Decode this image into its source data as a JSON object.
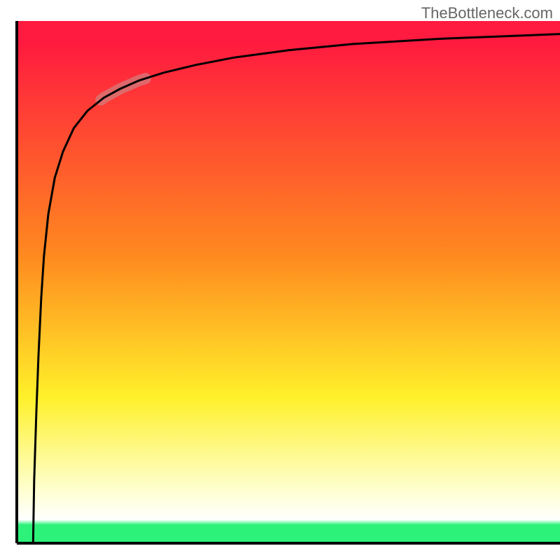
{
  "header": {
    "watermark": "TheBottleneck.com"
  },
  "chart_data": {
    "type": "line",
    "title": "",
    "xlabel": "",
    "ylabel": "",
    "xlim": [
      0,
      100
    ],
    "ylim": [
      0,
      100
    ],
    "axes": {
      "left_line_x": 3,
      "bottom_line_y": 0
    },
    "background_gradient": {
      "stops": [
        {
          "pos": 0.0,
          "color": "#ff1a3f"
        },
        {
          "pos": 0.04,
          "color": "#ff1a3f"
        },
        {
          "pos": 0.45,
          "color": "#ff8a1f"
        },
        {
          "pos": 0.72,
          "color": "#fff02a"
        },
        {
          "pos": 0.9,
          "color": "#feffd1"
        },
        {
          "pos": 0.955,
          "color": "#ffffff"
        },
        {
          "pos": 0.965,
          "color": "#2cf27a"
        },
        {
          "pos": 1.0,
          "color": "#2cf27a"
        }
      ]
    },
    "curve": {
      "description": "Steep rise from bottom near x=3, sharp knee near x≈18 y≈86, asymptote toward y≈97.5 as x→100",
      "x": [
        3,
        3.2,
        3.6,
        4,
        4.5,
        5,
        5.8,
        7,
        8.5,
        10.5,
        13,
        16,
        19,
        22.5,
        27,
        33,
        40,
        50,
        62,
        78,
        100
      ],
      "y": [
        0,
        12,
        25,
        36,
        47,
        55,
        63,
        70,
        75,
        79.5,
        82.8,
        85.3,
        87,
        88.6,
        90.1,
        91.6,
        93.0,
        94.4,
        95.6,
        96.6,
        97.5
      ]
    },
    "highlight_segment": {
      "x_range": [
        15.5,
        23.7
      ],
      "y_range": [
        85.0,
        89.0
      ],
      "color": "#d08080",
      "opacity": 0.7,
      "stroke_width_px": 16
    },
    "colors": {
      "curve": "#000000",
      "axes": "#000000",
      "watermark_text": "#666666"
    }
  }
}
